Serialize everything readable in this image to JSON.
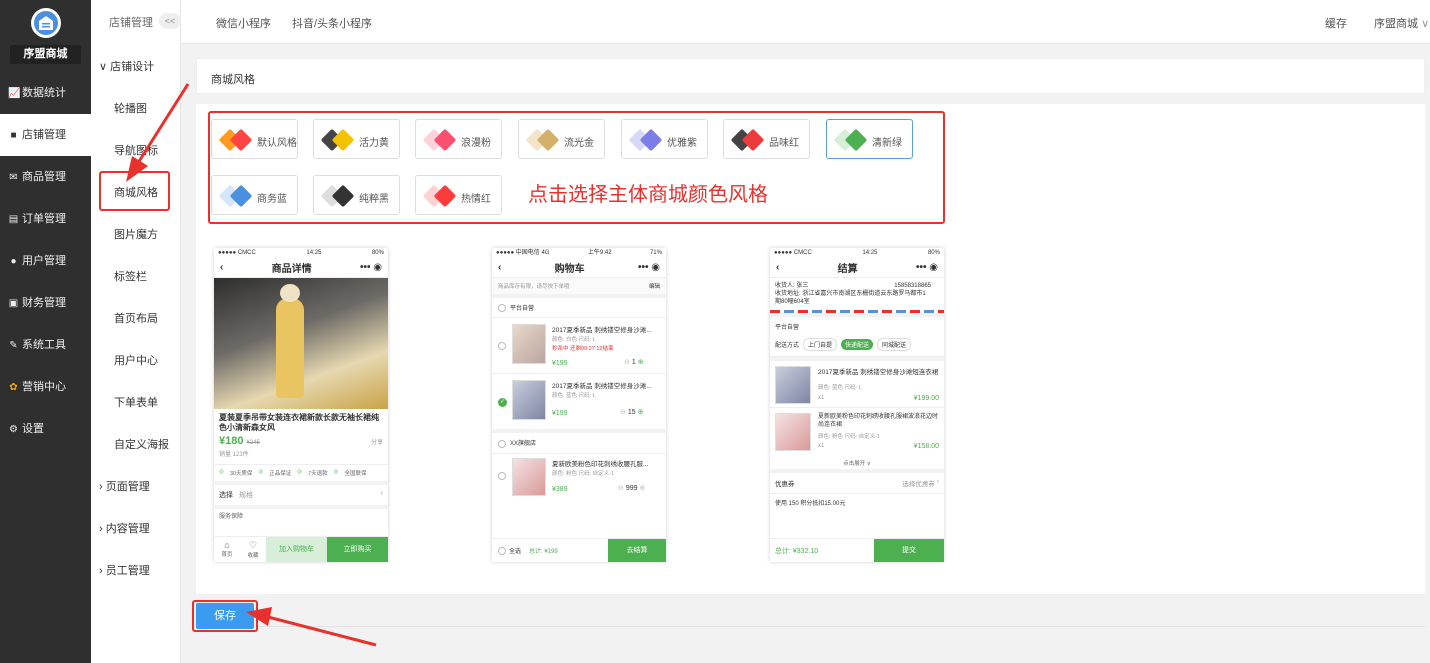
{
  "sidebar": {
    "shop_name": "序盟商城",
    "items": [
      {
        "label": "数据统计",
        "icon": "chart-icon"
      },
      {
        "label": "店铺管理",
        "icon": "store-icon"
      },
      {
        "label": "商品管理",
        "icon": "goods-icon"
      },
      {
        "label": "订单管理",
        "icon": "order-icon"
      },
      {
        "label": "用户管理",
        "icon": "user-icon"
      },
      {
        "label": "财务管理",
        "icon": "finance-icon"
      },
      {
        "label": "系统工具",
        "icon": "wrench-icon"
      },
      {
        "label": "营销中心",
        "icon": "marketing-icon"
      },
      {
        "label": "设置",
        "icon": "gear-icon"
      }
    ]
  },
  "subnav": {
    "title": "店铺管理",
    "collapse": "<<",
    "group1": "店铺设计",
    "links": [
      "轮播图",
      "导航图标",
      "商城风格",
      "图片魔方",
      "标签栏",
      "首页布局",
      "用户中心",
      "下单表单",
      "自定义海报"
    ],
    "groups": [
      "页面管理",
      "内容管理",
      "员工管理"
    ]
  },
  "topbar": {
    "tabs": [
      "微信小程序",
      "抖音/头条小程序"
    ],
    "cache": "缓存",
    "user": "序盟商城"
  },
  "page": {
    "title": "商城风格",
    "hint": "点击选择主体商城颜色风格",
    "save": "保存"
  },
  "styles": [
    {
      "name": "默认风格",
      "c1": "#ff9a1f",
      "c2": "#ff4444"
    },
    {
      "name": "活力黄",
      "c1": "#444444",
      "c2": "#f5c200"
    },
    {
      "name": "浪漫粉",
      "c1": "#ffd1d8",
      "c2": "#ff4f6e"
    },
    {
      "name": "流光金",
      "c1": "#f3e3c7",
      "c2": "#d4b06a"
    },
    {
      "name": "优雅紫",
      "c1": "#d8d8f8",
      "c2": "#7c7de8"
    },
    {
      "name": "品味红",
      "c1": "#444444",
      "c2": "#ee3a3a"
    },
    {
      "name": "清新绿",
      "c1": "#d6efd8",
      "c2": "#4caf50"
    },
    {
      "name": "商务蓝",
      "c1": "#d5e6fa",
      "c2": "#4a8fe0"
    },
    {
      "name": "纯粹黑",
      "c1": "#dddddd",
      "c2": "#333333"
    },
    {
      "name": "热情红",
      "c1": "#ffd1d1",
      "c2": "#ff3b3b"
    }
  ],
  "phone1": {
    "carrier": "●●●●● CMCC",
    "time": "14:25",
    "battery": "80%",
    "title": "商品详情",
    "name": "夏装夏季吊带女装连衣裙新款长款无袖长裙纯色小清新森女风",
    "price": "¥180",
    "old_price": "¥245",
    "sales": "销量 123件",
    "share": "分享",
    "tags": [
      "30天质保",
      "正品保证",
      "7天退款",
      "全国联保"
    ],
    "select": "选择",
    "spec": "规格",
    "service": "服务保障",
    "home": "首页",
    "fav": "收藏",
    "cart": "加入购物车",
    "buy": "立即购买"
  },
  "phone2": {
    "carrier": "●●●●● 中国电信 4G",
    "time": "上午9:42",
    "battery": "71%",
    "title": "购物车",
    "notice": "商品库存有限，请尽快下单哦",
    "edit": "编辑",
    "shop1": "平台自营",
    "shop2": "XX旗舰店",
    "items": [
      {
        "name": "2017夏季新品 刺绣镂空修身沙滩...",
        "spec": "颜色: 白色   尺码: L",
        "promo": "秒杀中 还剩00:27:12结束",
        "price": "¥199",
        "qty": "1"
      },
      {
        "name": "2017夏季新品 刺绣镂空修身沙滩...",
        "spec": "颜色: 蓝色   尺码: L",
        "promo": "",
        "price": "¥199",
        "qty": "15"
      },
      {
        "name": "夏新欧美粉色印花刺绣收腰孔服...",
        "spec": "颜色: 粉色   尺码: 自定义-1",
        "promo": "",
        "price": "¥389",
        "qty": "999"
      }
    ],
    "all": "全选",
    "total": "总计: ¥199",
    "checkout": "去结算"
  },
  "phone3": {
    "carrier": "●●●●● CMCC",
    "time": "14:25",
    "battery": "80%",
    "title": "结算",
    "receiver": "收货人: 张三",
    "phone": "15858318865",
    "address": "收货地址: 浙江省嘉兴市南湖区东栅街道云东路罗马都市1期80幢604室",
    "shop": "平台自营",
    "delivery": "配送方式",
    "opts": [
      "上门自提",
      "快递配送",
      "同城配送"
    ],
    "items": [
      {
        "name": "2017夏季新品 刺绣镂空修身沙滩短连衣裙",
        "spec": "颜色: 蓝色   尺码: L",
        "qty": "x1",
        "price": "¥199.00"
      },
      {
        "name": "夏新欧美粉色印花刺绣收腰孔服裙波浪花边时尚连衣裙",
        "spec": "颜色: 粉色   尺码: 自定义-1",
        "qty": "x1",
        "price": "¥158.00"
      }
    ],
    "expand": "点击展开",
    "coupon": "优惠券",
    "coupon_sel": "选择优惠券",
    "points": "使用 150 积分抵扣15.00元",
    "total": "总计: ¥332.10",
    "submit": "提交"
  }
}
